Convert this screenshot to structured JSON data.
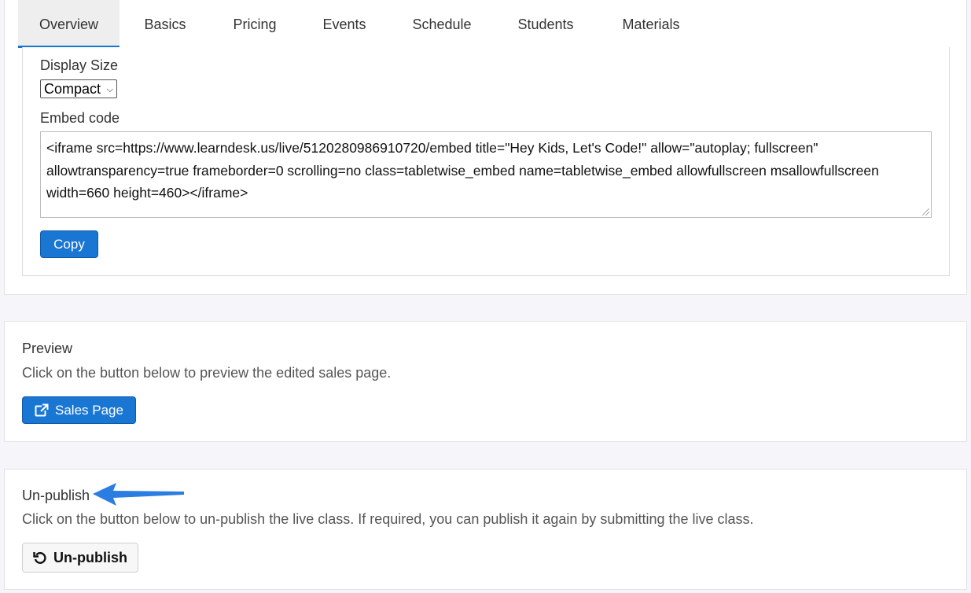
{
  "tabs": [
    {
      "label": "Overview",
      "active": true
    },
    {
      "label": "Basics"
    },
    {
      "label": "Pricing"
    },
    {
      "label": "Events"
    },
    {
      "label": "Schedule"
    },
    {
      "label": "Students"
    },
    {
      "label": "Materials"
    }
  ],
  "embed": {
    "display_size_label": "Display Size",
    "display_size_value": "Compact",
    "embed_code_label": "Embed code",
    "embed_code": "<iframe src=https://www.learndesk.us/live/5120280986910720/embed title=\"Hey Kids, Let's Code!\" allow=\"autoplay; fullscreen\" allowtransparency=true frameborder=0 scrolling=no class=tabletwise_embed name=tabletwise_embed allowfullscreen msallowfullscreen width=660 height=460></iframe>",
    "copy_label": "Copy"
  },
  "preview": {
    "title": "Preview",
    "description": "Click on the button below to preview the edited sales page.",
    "button_label": "Sales Page",
    "button_icon": "external-link-icon"
  },
  "unpublish": {
    "title": "Un-publish",
    "description": "Click on the button below to un-publish the live class. If required, you can publish it again by submitting the live class.",
    "button_label": "Un-publish",
    "button_icon": "undo-icon"
  },
  "colors": {
    "primary": "#1976d2",
    "annotation_arrow": "#2a7de1"
  }
}
